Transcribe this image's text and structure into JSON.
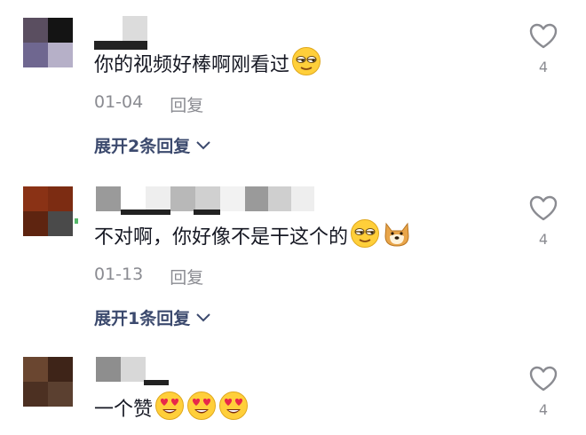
{
  "comments": [
    {
      "text": "你的视频好棒啊刚看过",
      "emojis": [
        "smirk-emoji"
      ],
      "date": "01-04",
      "reply_label": "回复",
      "expand_label": "展开2条回复",
      "likes": "4",
      "avatar_colors": [
        "#5a4e60",
        "#141414",
        "#6f6790",
        "#b6b0c8"
      ],
      "name_blocks": [
        "#8c8c8c",
        "#d5d5d5"
      ]
    },
    {
      "text": "不对啊，你好像不是干这个的",
      "emojis": [
        "smirk-emoji",
        "doge-emoji"
      ],
      "date": "01-13",
      "reply_label": "回复",
      "expand_label": "展开1条回复",
      "likes": "4",
      "avatar_colors": [
        "#8a3215",
        "#7c2c12",
        "#5e2410",
        "#4a4a4a"
      ],
      "name_blocks": [
        "#9a9a9a",
        "#d0d0d0",
        "#b8b8b8",
        "#d0d0d0",
        "#9a9a9a",
        "#cfcfcf",
        "#eeeeee"
      ]
    },
    {
      "text": "一个赞",
      "emojis": [
        "heart-eyes-emoji",
        "heart-eyes-emoji",
        "heart-eyes-emoji"
      ],
      "likes": "4",
      "avatar_colors": [
        "#6a4630",
        "#3e2418",
        "#4c3022",
        "#5b4030"
      ],
      "name_blocks": [
        "#8e8e8e",
        "#d8d8d8"
      ]
    }
  ],
  "colors": {
    "accent_link": "#3c4a6e",
    "meta_gray": "#8a8b91",
    "text": "#161823"
  }
}
